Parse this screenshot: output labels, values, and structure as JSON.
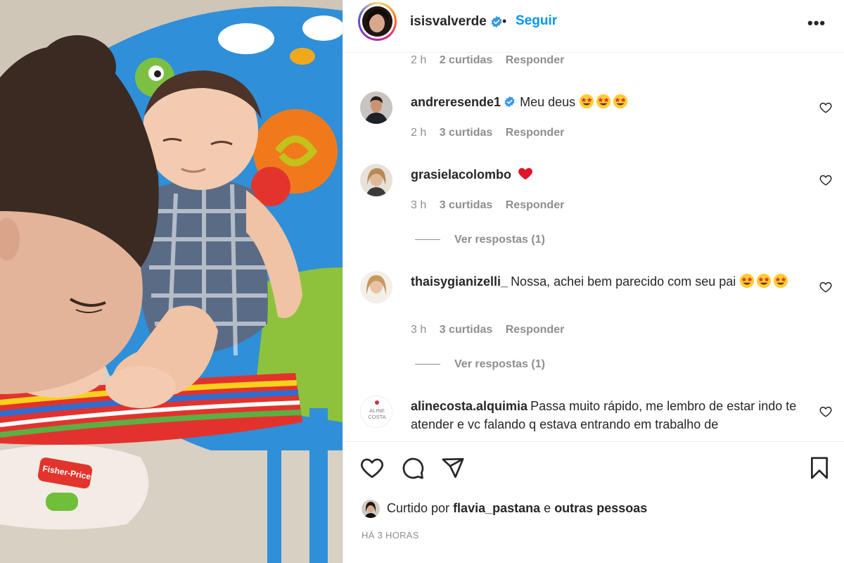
{
  "post": {
    "author": "isisvalverde",
    "follow_label": "Seguir",
    "dot": "•",
    "more_label": "•••"
  },
  "photo": {
    "brand_text": "Fisher-Price"
  },
  "top_meta": {
    "time": "2 h",
    "likes": "2 curtidas",
    "reply": "Responder"
  },
  "comments": [
    {
      "username": "andreresende1",
      "verified": true,
      "text": "Meu deus",
      "emojis": [
        "star-struck",
        "star-struck",
        "star-struck"
      ],
      "time": "2 h",
      "likes": "3 curtidas",
      "reply": "Responder"
    },
    {
      "username": "grasielacolombo",
      "verified": false,
      "text": "",
      "emojis": [
        "red-heart"
      ],
      "time": "3 h",
      "likes": "3 curtidas",
      "reply": "Responder",
      "view_replies": "Ver respostas (1)"
    },
    {
      "username": "thaisygianizelli_",
      "verified": false,
      "text": "Nossa, achei bem parecido com seu pai",
      "emojis": [
        "star-struck",
        "star-struck",
        "star-struck"
      ],
      "time": "3 h",
      "likes": "3 curtidas",
      "reply": "Responder",
      "view_replies": "Ver respostas (1)"
    },
    {
      "username": "alinecosta.alquimia",
      "verified": false,
      "text": "Passa muito rápido, me lembro de estar indo te atender e vc falando q estava entrando em trabalho de",
      "avatar_text": [
        "ALINE",
        "COSTA"
      ],
      "emojis": []
    }
  ],
  "actions": {
    "liked_prefix": "Curtido por",
    "liked_user": "flavia_pastana",
    "liked_and": "e",
    "liked_others": "outras pessoas",
    "timestamp": "HÁ 3 HORAS"
  },
  "icons": {
    "like": "heart-icon",
    "comment": "comment-icon",
    "share": "paper-plane-icon",
    "save": "bookmark-icon",
    "verified": "verified-badge-icon",
    "more": "more-options-icon"
  },
  "colors": {
    "link_blue": "#0095f6",
    "verified_blue": "#3897f0",
    "text_primary": "#262626",
    "text_secondary": "#8e8e8e",
    "divider": "#efefef"
  }
}
